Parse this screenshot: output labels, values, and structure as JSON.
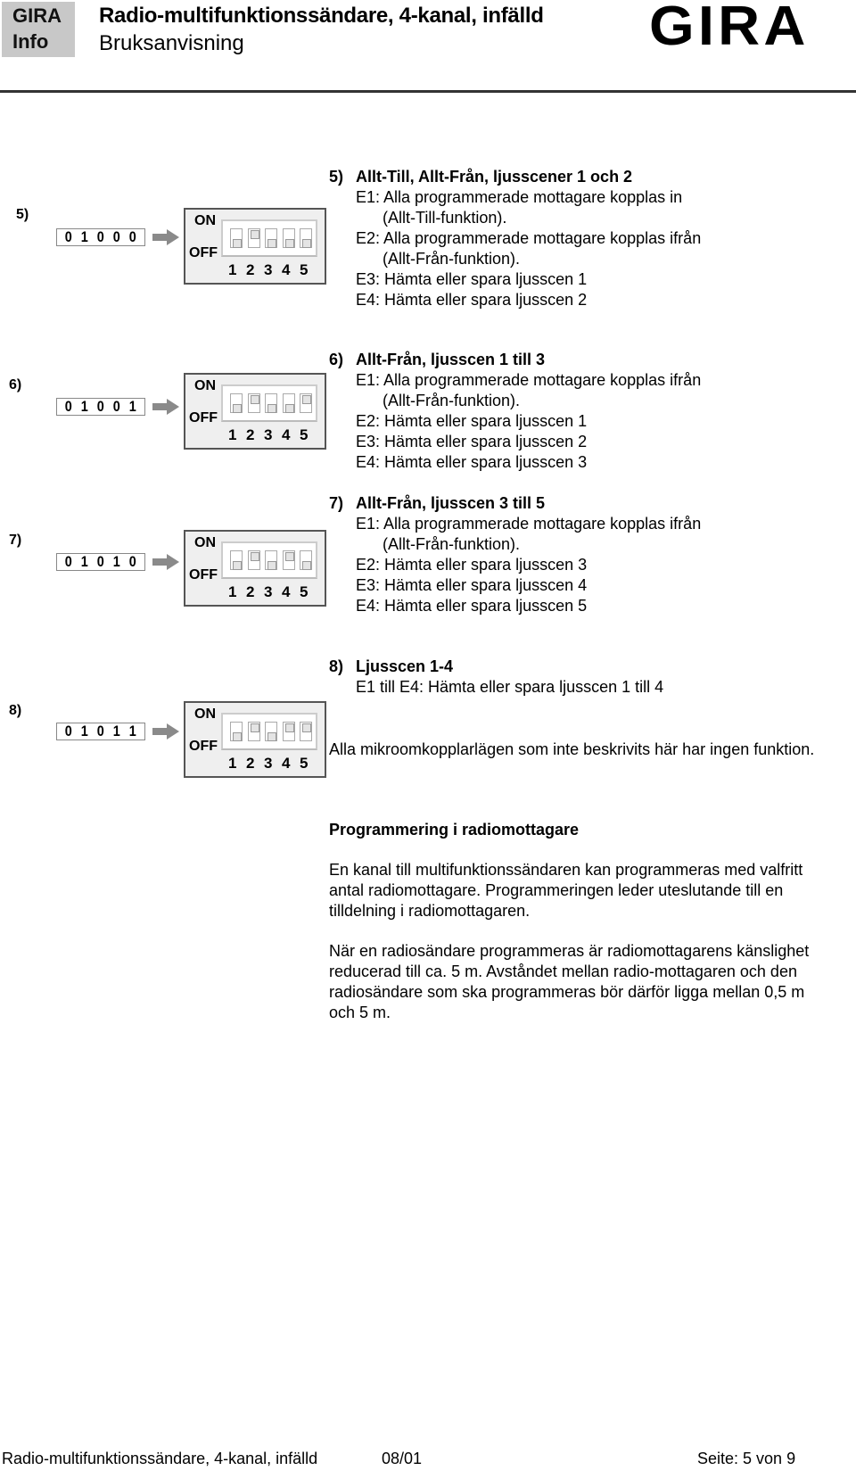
{
  "header": {
    "badge_line1": "GIRA",
    "badge_line2": "Info",
    "title": "Radio-multifunktionssändare, 4-kanal, infälld",
    "subtitle": "Bruksanvisning",
    "logo": "GIRA"
  },
  "dip_labels": {
    "on": "ON",
    "off": "OFF",
    "numbers": [
      "1",
      "2",
      "3",
      "4",
      "5"
    ]
  },
  "items": [
    {
      "num": "5)",
      "code": [
        "0",
        "1",
        "0",
        "0",
        "0"
      ],
      "switches": [
        "off",
        "on",
        "off",
        "off",
        "off"
      ],
      "heading_num": "5)",
      "heading": "Allt-Till, Allt-Från, ljusscener 1 och 2",
      "lines": [
        {
          "text": "E1: Alla programmerade mottagare kopplas in",
          "indent": false
        },
        {
          "text": "(Allt-Till-funktion).",
          "indent": true
        },
        {
          "text": "E2: Alla programmerade mottagare kopplas ifrån",
          "indent": false
        },
        {
          "text": "(Allt-Från-funktion).",
          "indent": true
        },
        {
          "text": "E3: Hämta eller spara ljusscen 1",
          "indent": false
        },
        {
          "text": "E4: Hämta eller spara ljusscen 2",
          "indent": false
        }
      ]
    },
    {
      "num": "6)",
      "code": [
        "0",
        "1",
        "0",
        "0",
        "1"
      ],
      "switches": [
        "off",
        "on",
        "off",
        "off",
        "on"
      ],
      "heading_num": "6)",
      "heading": "Allt-Från, ljusscen 1 till 3",
      "lines": [
        {
          "text": "E1: Alla programmerade mottagare kopplas ifrån",
          "indent": false
        },
        {
          "text": "(Allt-Från-funktion).",
          "indent": true
        },
        {
          "text": "E2: Hämta eller spara ljusscen 1",
          "indent": false
        },
        {
          "text": "E3: Hämta eller spara ljusscen 2",
          "indent": false
        },
        {
          "text": "E4: Hämta eller spara ljusscen 3",
          "indent": false
        }
      ]
    },
    {
      "num": "7)",
      "code": [
        "0",
        "1",
        "0",
        "1",
        "0"
      ],
      "switches": [
        "off",
        "on",
        "off",
        "on",
        "off"
      ],
      "heading_num": "7)",
      "heading": "Allt-Från, ljusscen 3 till 5",
      "lines": [
        {
          "text": "E1: Alla programmerade mottagare kopplas ifrån",
          "indent": false
        },
        {
          "text": "(Allt-Från-funktion).",
          "indent": true
        },
        {
          "text": "E2: Hämta eller spara ljusscen 3",
          "indent": false
        },
        {
          "text": "E3: Hämta eller spara ljusscen 4",
          "indent": false
        },
        {
          "text": "E4: Hämta eller spara ljusscen 5",
          "indent": false
        }
      ]
    },
    {
      "num": "8)",
      "code": [
        "0",
        "1",
        "0",
        "1",
        "1"
      ],
      "switches": [
        "off",
        "on",
        "off",
        "on",
        "on"
      ],
      "heading_num": "8)",
      "heading": "Ljusscen 1-4",
      "lines": [
        {
          "text": "E1 till E4: Hämta eller spara ljusscen 1 till 4",
          "indent": false
        }
      ]
    }
  ],
  "note": "Alla mikroomkopplarlägen som inte beskrivits här har ingen funktion.",
  "section": {
    "heading": "Programmering i radiomottagare",
    "paragraphs": [
      "En kanal till multifunktionssändaren kan programmeras med valfritt antal radiomottagare. Programmeringen leder uteslutande till en tilldelning i radiomottagaren.",
      "När en radiosändare programmeras är radiomottagarens känslighet reducerad till ca. 5 m. Avståndet mellan radio-mottagaren och den radiosändare som ska programmeras bör därför ligga mellan 0,5 m och 5 m."
    ]
  },
  "footer": {
    "product": "Radio-multifunktionssändare, 4-kanal, infälld",
    "date": "08/01",
    "page": "Seite: 5 von 9"
  }
}
